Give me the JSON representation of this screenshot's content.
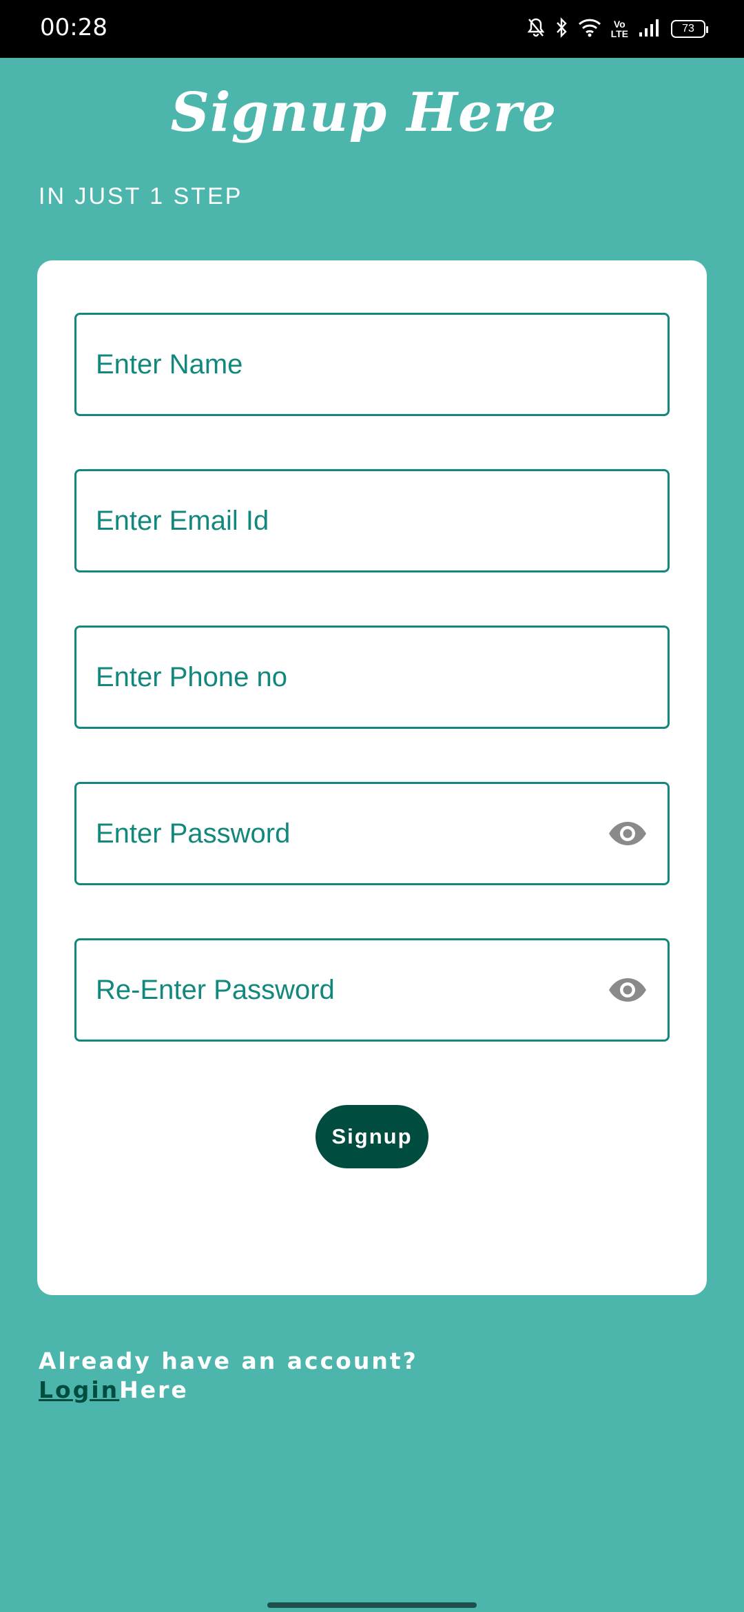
{
  "status_bar": {
    "time": "00:28",
    "battery": "73",
    "volte": "Vo LTE",
    "icons": [
      "mute-bell-icon",
      "bluetooth-icon",
      "wifi-icon",
      "volte-icon",
      "signal-icon",
      "battery-icon"
    ]
  },
  "header": {
    "title": "Signup Here",
    "subtitle": "IN JUST 1 STEP"
  },
  "form": {
    "name_placeholder": "Enter Name",
    "email_placeholder": "Enter Email Id",
    "phone_placeholder": "Enter Phone no",
    "password_placeholder": "Enter Password",
    "reenter_password_placeholder": "Re-Enter Password",
    "submit_label": "Signup"
  },
  "footer": {
    "prompt": "Already have an account?",
    "login_link": "Login",
    "login_suffix": "Here"
  },
  "colors": {
    "background": "#4db6ac",
    "accent": "#12887c",
    "button": "#004d40"
  }
}
